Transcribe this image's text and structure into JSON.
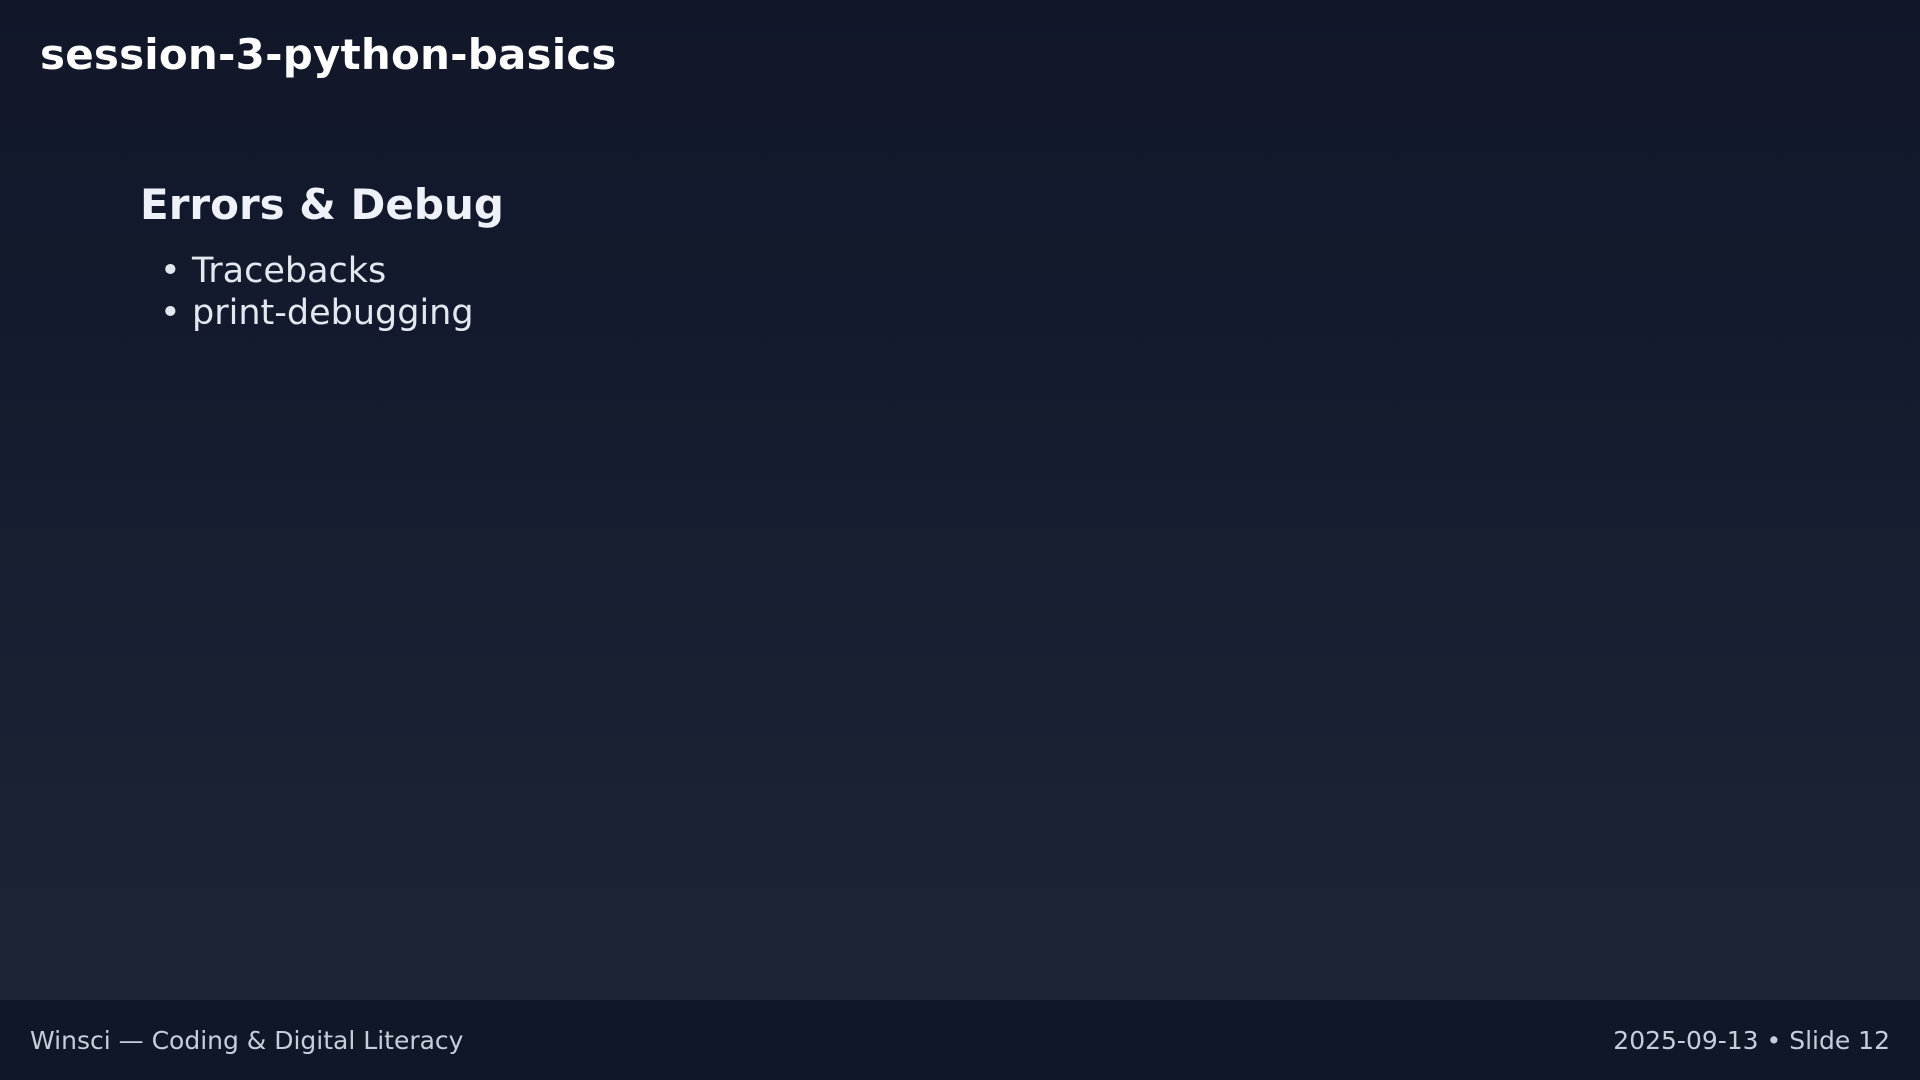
{
  "deck": {
    "title": "session-3-python-basics"
  },
  "slide": {
    "heading": "Errors & Debug",
    "bullet_glyph": "•",
    "bullets": [
      "Tracebacks",
      "print-debugging"
    ]
  },
  "footer": {
    "left_text": "Winsci — Coding & Digital Literacy",
    "right_text": "2025-09-13 • Slide 12"
  },
  "colors": {
    "background_top": "#111729",
    "background_bottom": "#1d2536",
    "footer_background": "#101726",
    "title_text": "#ffffff",
    "body_text": "#e3e7ef",
    "footer_text": "#c7cedb"
  }
}
